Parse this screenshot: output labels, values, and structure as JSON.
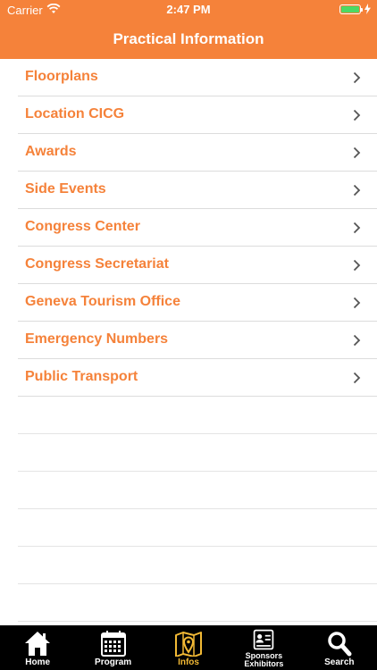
{
  "status": {
    "carrier": "Carrier",
    "time": "2:47 PM"
  },
  "header": {
    "title": "Practical Information"
  },
  "colors": {
    "accent": "#f5823a",
    "tab_active": "#f2b935",
    "tabbar": "#000000"
  },
  "items": [
    {
      "label": "Floorplans"
    },
    {
      "label": "Location CICG"
    },
    {
      "label": "Awards"
    },
    {
      "label": "Side Events"
    },
    {
      "label": "Congress Center"
    },
    {
      "label": "Congress Secretariat"
    },
    {
      "label": "Geneva Tourism Office"
    },
    {
      "label": "Emergency Numbers"
    },
    {
      "label": "Public Transport"
    }
  ],
  "tabs": [
    {
      "label": "Home",
      "icon": "home-icon",
      "active": false
    },
    {
      "label": "Program",
      "icon": "calendar-icon",
      "active": false
    },
    {
      "label": "Infos",
      "icon": "map-pin-icon",
      "active": true
    },
    {
      "label": "Sponsors\nExhibitors",
      "line1": "Sponsors",
      "line2": "Exhibitors",
      "icon": "id-badge-icon",
      "active": false
    },
    {
      "label": "Search",
      "icon": "search-icon",
      "active": false
    }
  ]
}
